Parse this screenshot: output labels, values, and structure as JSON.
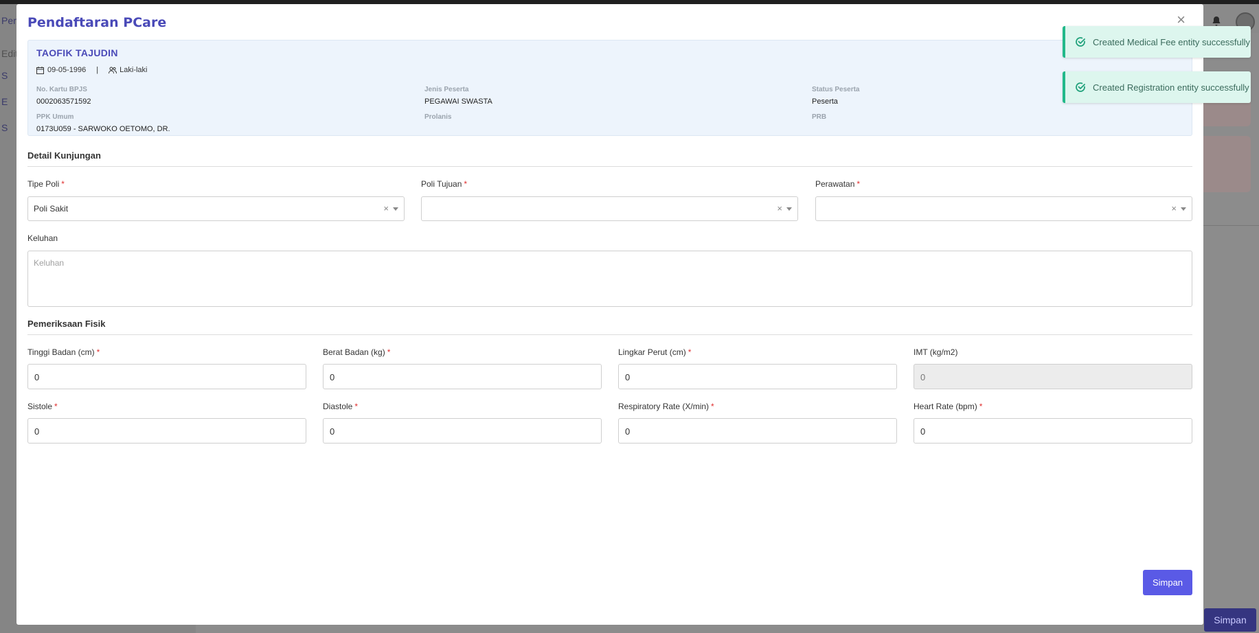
{
  "background": {
    "sidebar_texts": [
      "Pen",
      "Edit",
      "S",
      "E",
      "S"
    ],
    "bottom_save_label": "Simpan"
  },
  "modal": {
    "title": "Pendaftaran PCare",
    "close_label": "×"
  },
  "patient": {
    "name": "TAOFIK TAJUDIN",
    "birth_date": "09-05-1996",
    "separator": "|",
    "gender": "Laki-laki",
    "fields": {
      "no_kartu_bpjs": {
        "label": "No. Kartu BPJS",
        "value": "0002063571592"
      },
      "jenis_peserta": {
        "label": "Jenis Peserta",
        "value": "PEGAWAI SWASTA"
      },
      "status_peserta": {
        "label": "Status Peserta",
        "value": "Peserta"
      },
      "ppk_umum": {
        "label": "PPK Umum",
        "value": "0173U059 - SARWOKO OETOMO, DR."
      },
      "prolanis": {
        "label": "Prolanis",
        "value": ""
      },
      "prb": {
        "label": "PRB",
        "value": ""
      }
    }
  },
  "detail_kunjungan": {
    "title": "Detail Kunjungan",
    "tipe_poli": {
      "label": "Tipe Poli",
      "value": "Poli Sakit"
    },
    "poli_tujuan": {
      "label": "Poli Tujuan",
      "value": ""
    },
    "perawatan": {
      "label": "Perawatan",
      "value": ""
    },
    "keluhan": {
      "label": "Keluhan",
      "placeholder": "Keluhan",
      "value": ""
    }
  },
  "pemeriksaan_fisik": {
    "title": "Pemeriksaan Fisik",
    "tinggi_badan": {
      "label": "Tinggi Badan (cm)",
      "value": "0"
    },
    "berat_badan": {
      "label": "Berat Badan (kg)",
      "value": "0"
    },
    "lingkar_perut": {
      "label": "Lingkar Perut (cm)",
      "value": "0"
    },
    "imt": {
      "label": "IMT (kg/m2)",
      "value": "0"
    },
    "sistole": {
      "label": "Sistole",
      "value": "0"
    },
    "diastole": {
      "label": "Diastole",
      "value": "0"
    },
    "respiratory_rate": {
      "label": "Respiratory Rate (X/min)",
      "value": "0"
    },
    "heart_rate": {
      "label": "Heart Rate (bpm)",
      "value": "0"
    }
  },
  "required_mark": "*",
  "clear_mark": "×",
  "submit_label": "Simpan",
  "toasts": [
    {
      "message": "Created Medical Fee entity successfully"
    },
    {
      "message": "Created Registration entity successfully"
    }
  ],
  "colors": {
    "accent": "#4a4ab8",
    "button": "#5a5ae6",
    "toast_border": "#22b98a",
    "required": "#e03030"
  }
}
